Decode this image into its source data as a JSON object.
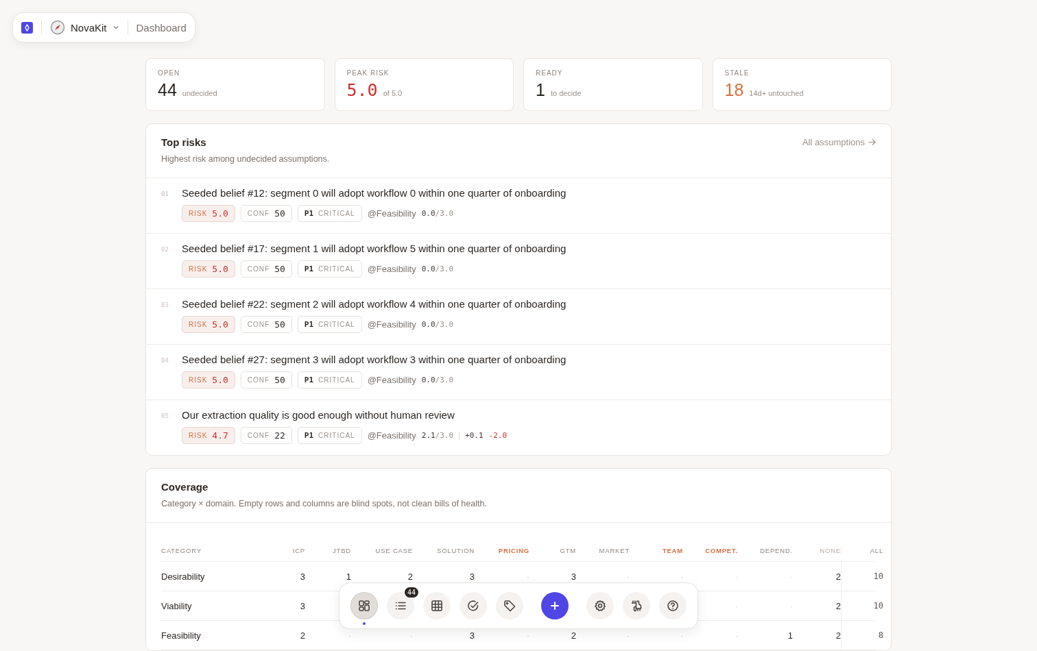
{
  "header": {
    "app": "NovaKit",
    "page": "Dashboard"
  },
  "stats": [
    {
      "label": "OPEN",
      "value": "44",
      "note": "undecided",
      "kind": "plain"
    },
    {
      "label": "PEAK RISK",
      "value": "5.0",
      "note": "of 5.0",
      "kind": "danger"
    },
    {
      "label": "READY",
      "value": "1",
      "note": "to decide",
      "kind": "plain"
    },
    {
      "label": "STALE",
      "value": "18",
      "note": "14d+ untouched",
      "kind": "warn"
    }
  ],
  "top_risks": {
    "title": "Top risks",
    "subtitle": "Highest risk among undecided assumptions.",
    "link": "All assumptions",
    "items": [
      {
        "rank": "01",
        "title": "Seeded belief #12: segment 0 will adopt workflow 0 within one quarter of onboarding",
        "risk_label": "RISK",
        "risk": "5.0",
        "conf_label": "CONF",
        "conf": "50",
        "priority": "P1",
        "severity": "CRITICAL",
        "domain": "@Feasibility",
        "score": "0.0",
        "score_max": "/3.0"
      },
      {
        "rank": "02",
        "title": "Seeded belief #17: segment 1 will adopt workflow 5 within one quarter of onboarding",
        "risk_label": "RISK",
        "risk": "5.0",
        "conf_label": "CONF",
        "conf": "50",
        "priority": "P1",
        "severity": "CRITICAL",
        "domain": "@Feasibility",
        "score": "0.0",
        "score_max": "/3.0"
      },
      {
        "rank": "03",
        "title": "Seeded belief #22: segment 2 will adopt workflow 4 within one quarter of onboarding",
        "risk_label": "RISK",
        "risk": "5.0",
        "conf_label": "CONF",
        "conf": "50",
        "priority": "P1",
        "severity": "CRITICAL",
        "domain": "@Feasibility",
        "score": "0.0",
        "score_max": "/3.0"
      },
      {
        "rank": "04",
        "title": "Seeded belief #27: segment 3 will adopt workflow 3 within one quarter of onboarding",
        "risk_label": "RISK",
        "risk": "5.0",
        "conf_label": "CONF",
        "conf": "50",
        "priority": "P1",
        "severity": "CRITICAL",
        "domain": "@Feasibility",
        "score": "0.0",
        "score_max": "/3.0"
      },
      {
        "rank": "05",
        "title": "Our extraction quality is good enough without human review",
        "risk_label": "RISK",
        "risk": "4.7",
        "conf_label": "CONF",
        "conf": "22",
        "priority": "P1",
        "severity": "CRITICAL",
        "domain": "@Feasibility",
        "score": "2.1",
        "score_max": "/3.0",
        "deltas": [
          {
            "text": "+0.1",
            "kind": "up"
          },
          {
            "text": "-2.0",
            "kind": "down"
          }
        ]
      }
    ]
  },
  "coverage": {
    "title": "Coverage",
    "subtitle": "Category × domain. Empty rows and columns are blind spots, not clean bills of health.",
    "category_header": "CATEGORY",
    "columns": [
      {
        "label": "ICP",
        "kind": "normal"
      },
      {
        "label": "JTBD",
        "kind": "normal"
      },
      {
        "label": "USE CASE",
        "kind": "normal"
      },
      {
        "label": "SOLUTION",
        "kind": "normal"
      },
      {
        "label": "PRICING",
        "kind": "blind"
      },
      {
        "label": "GTM",
        "kind": "normal"
      },
      {
        "label": "MARKET",
        "kind": "normal"
      },
      {
        "label": "TEAM",
        "kind": "blind"
      },
      {
        "label": "COMPET.",
        "kind": "blind"
      },
      {
        "label": "DEPEND.",
        "kind": "normal"
      },
      {
        "label": "NONE",
        "kind": "faint"
      },
      {
        "label": "ALL",
        "kind": "total"
      }
    ],
    "rows": [
      {
        "category": "Desirability",
        "cells": [
          "3",
          "1",
          "2",
          "3",
          "·",
          "3",
          "·",
          "·",
          "·",
          "·",
          "2",
          "10"
        ]
      },
      {
        "category": "Viability",
        "cells": [
          "3",
          "",
          "",
          "",
          "",
          "",
          "",
          "",
          "·",
          "·",
          "2",
          "10"
        ]
      },
      {
        "category": "Feasibility",
        "cells": [
          "2",
          "·",
          "·",
          "3",
          "·",
          "2",
          "·",
          "·",
          "·",
          "1",
          "2",
          "8"
        ]
      }
    ]
  },
  "toolbar": [
    {
      "kind": "tool",
      "selected": true
    },
    {
      "kind": "tool",
      "selected": false,
      "badge": "44"
    },
    {
      "kind": "tool",
      "selected": false
    },
    {
      "kind": "tool",
      "selected": false
    },
    {
      "kind": "tool",
      "selected": false
    },
    {
      "kind": "divider"
    },
    {
      "kind": "primary"
    },
    {
      "kind": "divider"
    },
    {
      "kind": "tool",
      "selected": false
    },
    {
      "kind": "tool",
      "selected": false
    },
    {
      "kind": "tool",
      "selected": false
    }
  ]
}
